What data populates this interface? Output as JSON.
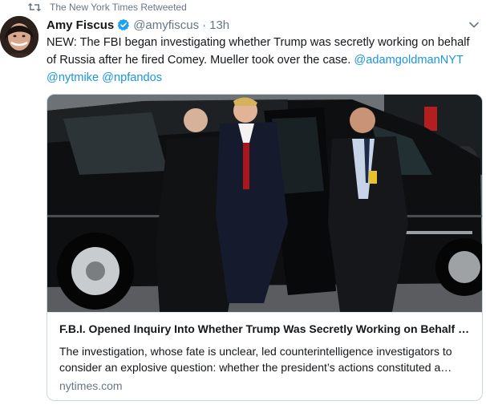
{
  "retweet": {
    "icon": "retweet-icon",
    "label": "The New York Times Retweeted"
  },
  "tweet": {
    "author_name": "Amy Fiscus",
    "verified_icon": "verified-badge-icon",
    "handle": "@amyfiscus",
    "separator": "·",
    "time": "13h",
    "text_main": "NEW: The FBI began investigating whether Trump was secretly working on behalf of Russia after he fired Comey. Mueller took over the case. ",
    "mentions": [
      "@adamgoldmanNYT",
      "@nytmike",
      "@npfandos"
    ]
  },
  "card": {
    "title": "F.B.I. Opened Inquiry Into Whether Trump Was Secretly Working on Behalf of Russia",
    "description": "The investigation, whose fate is unclear, led counterintelligence investigators to consider an explosive question: whether the president’s actions constituted a possible threat to national security.",
    "domain": "nytimes.com"
  },
  "colors": {
    "link": "#1b95e0",
    "secondary": "#657786",
    "verified": "#1da1f2",
    "border": "#ccd6dd"
  }
}
